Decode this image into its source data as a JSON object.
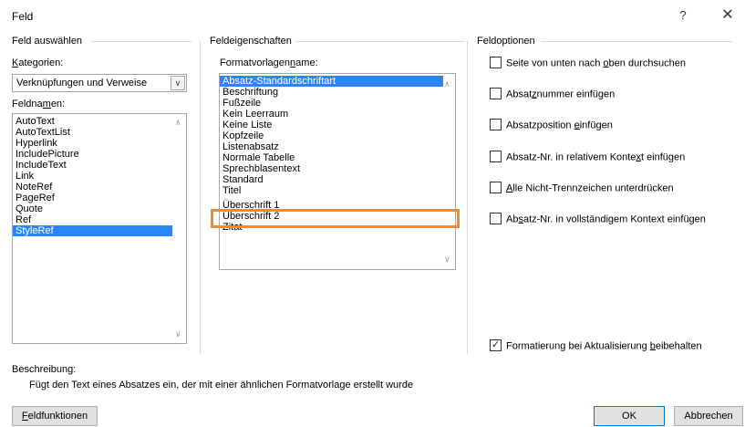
{
  "window": {
    "title": "Feld",
    "help_glyph": "?",
    "close_glyph": "✕"
  },
  "left": {
    "group_title": "Feld auswählen",
    "categories_label_pre": "",
    "categories_label_u": "K",
    "categories_label_post": "ategorien:",
    "category_value": "Verknüpfungen und Verweise",
    "fieldnames_label_pre": "Feldna",
    "fieldnames_label_u": "m",
    "fieldnames_label_post": "en:",
    "fieldnames": [
      "AutoText",
      "AutoTextList",
      "Hyperlink",
      "IncludePicture",
      "IncludeText",
      "Link",
      "NoteRef",
      "PageRef",
      "Quote",
      "Ref",
      "StyleRef"
    ],
    "selected_field": "StyleRef"
  },
  "middle": {
    "group_title": "Feldeigenschaften",
    "style_label_pre": "Formatvorlagen",
    "style_label_u": "n",
    "style_label_post": "ame:",
    "styles": [
      "Absatz-Standardschriftart",
      "Beschriftung",
      "Fußzeile",
      "Kein Leerraum",
      "Keine Liste",
      "Kopfzeile",
      "Listenabsatz",
      "Normale Tabelle",
      "Sprechblasentext",
      "Standard",
      "Titel",
      "Überschrift 1",
      "Überschrift 2",
      "Zitat"
    ],
    "selected_style": "Absatz-Standardschriftart"
  },
  "right": {
    "group_title": "Feldoptionen",
    "options": [
      {
        "pre": "Seite von unten nach ",
        "u": "o",
        "post": "ben durchsuchen",
        "checked": false
      },
      {
        "pre": "Absat",
        "u": "z",
        "post": "nummer einfügen",
        "checked": false
      },
      {
        "pre": "Absatzposition ",
        "u": "e",
        "post": "infügen",
        "checked": false
      },
      {
        "pre": "Absatz-Nr. in relativem Konte",
        "u": "x",
        "post": "t einfügen",
        "checked": false
      },
      {
        "pre": "",
        "u": "A",
        "post": "lle Nicht-Trennzeichen unterdrücken",
        "checked": false
      },
      {
        "pre": "Ab",
        "u": "s",
        "post": "atz-Nr. in vollständigem Kontext einfügen",
        "checked": false
      }
    ],
    "keep_format": {
      "pre": "Formatierung bei Aktualisierung ",
      "u": "b",
      "post": "eibehalten",
      "checked": true
    }
  },
  "description": {
    "label": "Beschreibung:",
    "text": "Fügt den Text eines Absatzes ein, der mit einer ähnlichen Formatvorlage erstellt wurde"
  },
  "buttons": {
    "field_codes_u": "F",
    "field_codes_rest": "eldfunktionen",
    "ok": "OK",
    "cancel": "Abbrechen"
  },
  "colors": {
    "selection": "#2d84ff",
    "highlight": "#f28b2b",
    "default_border": "#0078d7"
  }
}
